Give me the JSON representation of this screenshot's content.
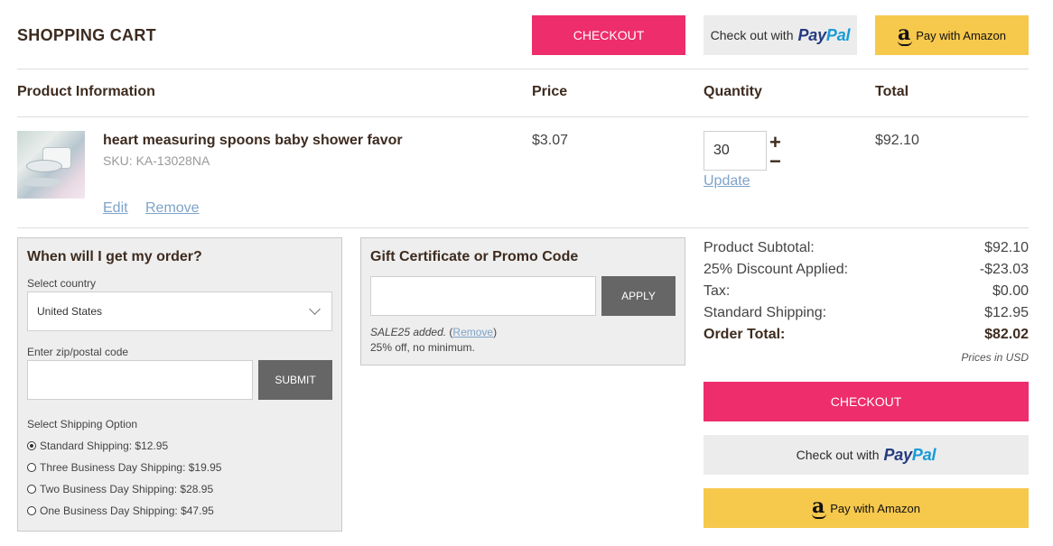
{
  "header": {
    "title": "SHOPPING CART",
    "checkout_label": "CHECKOUT",
    "paypal_lead": "Check out with",
    "paypal_brand_a": "Pay",
    "paypal_brand_b": "Pal",
    "amazon_label": "Pay with Amazon"
  },
  "table": {
    "headers": {
      "product": "Product Information",
      "price": "Price",
      "quantity": "Quantity",
      "total": "Total"
    }
  },
  "item": {
    "name": "heart measuring spoons baby shower favor",
    "sku": "SKU: KA-13028NA",
    "price": "$3.07",
    "quantity": "30",
    "total": "$92.10",
    "edit_label": "Edit",
    "remove_label": "Remove",
    "update_label": "Update",
    "plus_symbol": "+",
    "minus_symbol": "−"
  },
  "delivery": {
    "title": "When will I get my order?",
    "country_label": "Select country",
    "country_value": "United States",
    "zip_label": "Enter zip/postal code",
    "zip_value": "",
    "submit_label": "SUBMIT",
    "shipping_label": "Select Shipping Option",
    "options": [
      {
        "label": "Standard Shipping: $12.95",
        "checked": true
      },
      {
        "label": "Three Business Day Shipping: $19.95",
        "checked": false
      },
      {
        "label": "Two Business Day Shipping: $28.95",
        "checked": false
      },
      {
        "label": "One Business Day Shipping: $47.95",
        "checked": false
      }
    ]
  },
  "promo": {
    "title": "Gift Certificate or Promo Code",
    "input_value": "",
    "apply_label": "APPLY",
    "applied_code_text": "SALE25 added.",
    "remove_label": "Remove",
    "description": "25% off, no minimum."
  },
  "summary": {
    "rows": [
      {
        "label": "Product Subtotal:",
        "value": "$92.10"
      },
      {
        "label": "25% Discount Applied:",
        "value": "-$23.03"
      },
      {
        "label": "Tax:",
        "value": "$0.00"
      },
      {
        "label": "Standard Shipping:",
        "value": "$12.95"
      }
    ],
    "total_label": "Order Total:",
    "total_value": "$82.02",
    "currency_note": "Prices in USD",
    "checkout_label": "CHECKOUT",
    "paypal_lead": "Check out with",
    "amazon_label": "Pay with Amazon"
  },
  "colors": {
    "checkout_pink": "#ee2d6c",
    "amazon_yellow": "#f6c84c",
    "paypal_bg": "#ececec",
    "link_blue": "#7ea3c9",
    "heading_brown": "#3d2b1f"
  }
}
